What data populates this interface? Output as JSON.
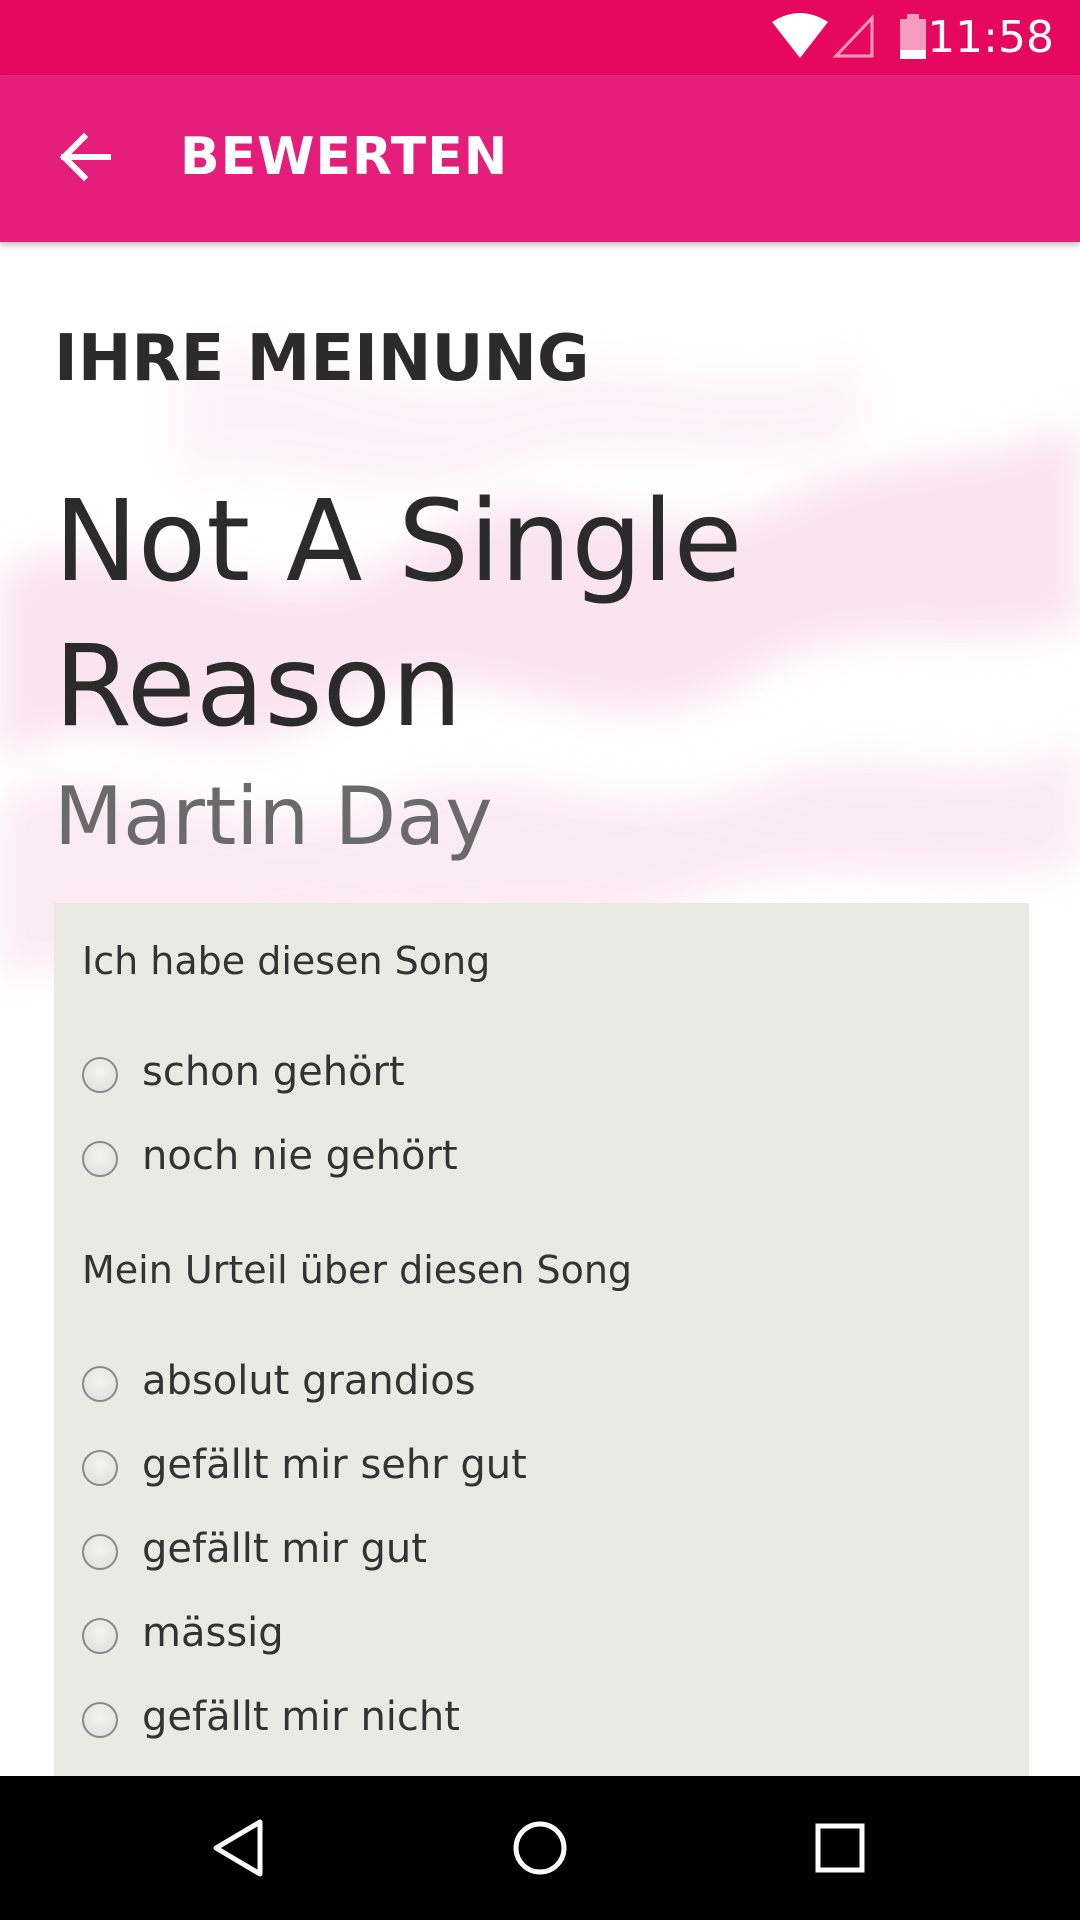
{
  "status_bar": {
    "time": "11:58",
    "icons": [
      "wifi-icon",
      "cell-signal-icon",
      "battery-icon"
    ]
  },
  "app_bar": {
    "back_icon": "arrow-back-icon",
    "title": "BEWERTEN"
  },
  "content": {
    "section_title": "IHRE MEINUNG",
    "song_title": "Not A Single Reason",
    "artist": "Martin Day"
  },
  "card": {
    "question1": "Ich habe diesen Song",
    "options1": [
      "schon gehört",
      "noch nie gehört"
    ],
    "question2": "Mein Urteil über diesen Song",
    "options2": [
      "absolut grandios",
      "gefällt mir sehr gut",
      "gefällt mir gut",
      "mässig",
      "gefällt mir nicht"
    ]
  },
  "nav_bar": {
    "buttons": [
      "back-triangle-icon",
      "home-circle-icon",
      "recents-square-icon"
    ]
  },
  "colors": {
    "status_bar": "#e6075f",
    "app_bar": "#e51e7b",
    "card_bg": "#eaeae5",
    "text_dark": "#2b2b2b"
  }
}
